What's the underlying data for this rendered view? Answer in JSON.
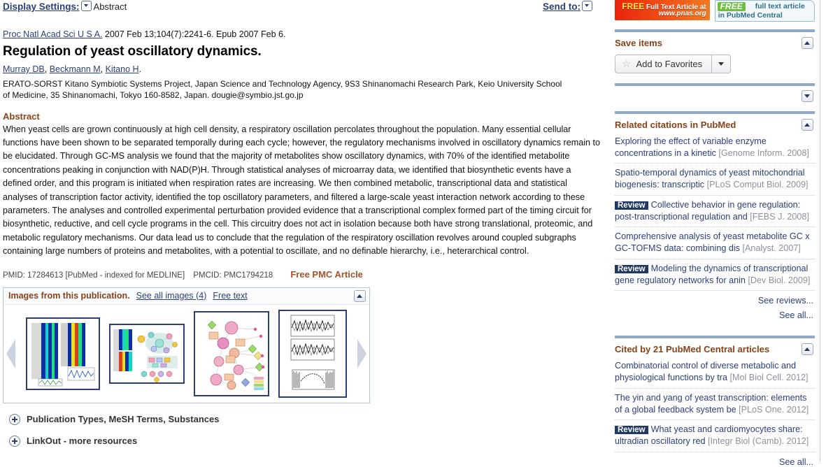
{
  "header": {
    "display_settings_label": "Display Settings:",
    "display_mode": "Abstract",
    "send_to_label": "Send to:"
  },
  "article": {
    "journal": "Proc Natl Acad Sci U S A.",
    "citation_rest": " 2007 Feb 13;104(7):2241-6. Epub 2007 Feb 6.",
    "title": "Regulation of yeast oscillatory dynamics.",
    "authors": [
      "Murray DB",
      "Beckmann M",
      "Kitano H"
    ],
    "affiliation": "ERATO-SORST Kitano Symbiotic Systems Project, Japan Science and Technology Agency, 9S3 Shinanomachi Research Park, Keio University School of Medicine, 35 Shinanomachi, Tokyo 160-8582, Japan. dougie@symbio.jst.go.jp",
    "abstract_heading": "Abstract",
    "abstract": "When yeast cells are grown continuously at high cell density, a respiratory oscillation percolates throughout the population. Many essential cellular functions have been shown to be separated temporally during each cycle; however, the regulatory mechanisms involved in oscillatory dynamics remain to be elucidated. Through GC-MS analysis we found that the majority of metabolites show oscillatory dynamics, with 70% of the identified metabolite concentrations peaking in conjunction with NAD(P)H. Through statistical analyses of microarray data, we identified that biosynthetic events have a defined order, and this program is initiated when respiration rates are increasing. We then combined metabolic, transcriptional data and statistical analyses of transcription factor activity, identified the top oscillatory parameters, and filtered a large-scale yeast interaction network according to these parameters. The analyses and controlled experimental perturbation provided evidence that a transcriptional complex formed part of the timing circuit for biosynthetic, reductive, and cell cycle programs in the cell. This circuitry does not act in isolation because both have strong translational, proteomic, and metabolic regulatory mechanisms. Our data lead us to conclude that the regulation of the respiratory oscillation revolves around coupled subgraphs containing large numbers of proteins and metabolites, with a potential to oscillate, and no definable hierarchy, i.e., heterarchical control.",
    "pmid": "PMID: 17284613 [PubMed - indexed for MEDLINE]",
    "pmcid": "PMCID: PMC1794218",
    "free_pmc": "Free PMC Article"
  },
  "images_panel": {
    "title": "Images from this publication.",
    "see_all_label": "See all images (4)",
    "free_text_label": "Free text",
    "thumb_count": 4
  },
  "expanders": [
    {
      "label": "Publication Types, MeSH Terms, Substances"
    },
    {
      "label": "LinkOut - more resources"
    }
  ],
  "ads": {
    "pnas": {
      "free": "FREE",
      "line1": "Full Text Article at",
      "line2": "www.pnas.org"
    },
    "pmc": {
      "free": "FREE",
      "line1": "full text article",
      "line2": "in PubMed Central"
    }
  },
  "sidebar": {
    "save_items": {
      "heading": "Save items",
      "add_to_favorites_label": "Add to Favorites",
      "star_glyph": "☆"
    },
    "related_citations": {
      "heading": "Related citations in PubMed",
      "items": [
        {
          "tag": "",
          "text": "Exploring the effect of variable enzyme concentrations in a kinetic",
          "source": "[Genome Inform. 2008]"
        },
        {
          "tag": "",
          "text": "Spatio-temporal dynamics of yeast mitochondrial biogenesis: transcriptic",
          "source": "[PLoS Comput Biol. 2009]"
        },
        {
          "tag": "Review",
          "text": "Collective behavior in gene regulation: post-transcriptional regulation and",
          "source": "[FEBS J. 2008]"
        },
        {
          "tag": "",
          "text": "Comprehensive analysis of yeast metabolite GC x GC-TOFMS data: combining dis",
          "source": "[Analyst. 2007]"
        },
        {
          "tag": "Review",
          "text": "Modeling the dynamics of transcriptional gene regulatory networks for anin",
          "source": "[Dev Biol. 2009]"
        }
      ],
      "see_reviews_label": "See reviews...",
      "see_all_label": "See all..."
    },
    "cited_by": {
      "heading": "Cited by 21 PubMed Central articles",
      "items": [
        {
          "tag": "",
          "text": "Combinatorial control of diverse metabolic and physiological functions by tra",
          "source": "[Mol Biol Cell. 2012]"
        },
        {
          "tag": "",
          "text": "The yin and yang of yeast transcription: elements of a global feedback system be",
          "source": "[PLoS One. 2012]"
        },
        {
          "tag": "Review",
          "text": "What yeast and cardiomyocytes share: ultradian oscillatory red",
          "source": "[Integr Biol (Camb). 2012]"
        }
      ],
      "see_all_label": "See all..."
    }
  },
  "colors": {
    "link": "#2c3e7a",
    "section_heading": "#8a4117",
    "rule": "#8fa9c4",
    "review_badge_bg": "#1f3864"
  }
}
